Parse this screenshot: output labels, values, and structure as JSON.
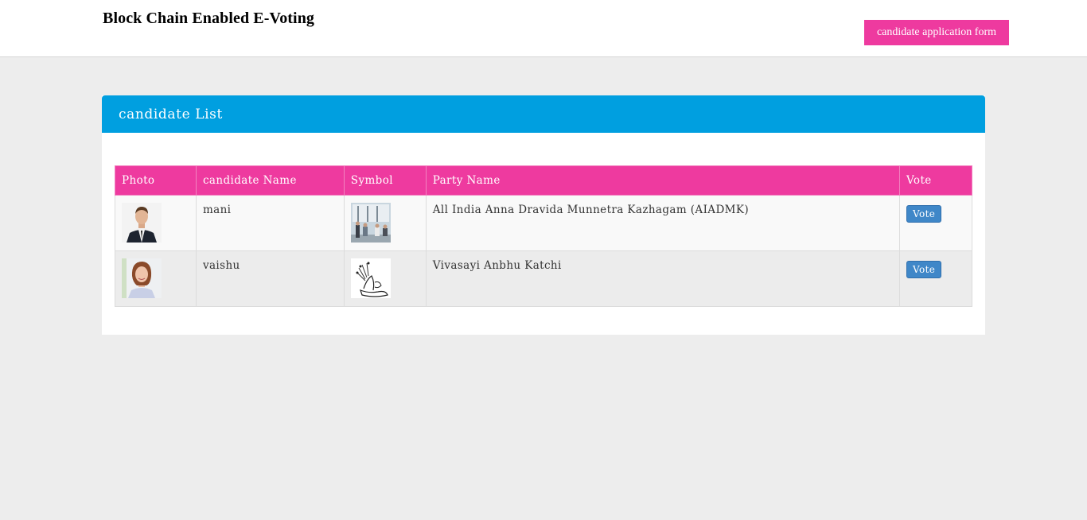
{
  "header": {
    "brand": "Block Chain Enabled E-Voting",
    "apply_button": "candidate application form"
  },
  "panel": {
    "title": "candidate List"
  },
  "table": {
    "columns": [
      "Photo",
      "candidate Name",
      "Symbol",
      "Party Name",
      "Vote"
    ],
    "rows": [
      {
        "name": "mani",
        "party": "All India Anna Dravida Munnetra Kazhagam (AIADMK)",
        "vote": "Vote"
      },
      {
        "name": "vaishu",
        "party": "Vivasayi Anbhu Katchi",
        "vote": "Vote"
      }
    ]
  },
  "colors": {
    "accent_pink": "#ee3a9f",
    "panel_blue": "#009fe0",
    "vote_blue": "#3f87c8"
  }
}
